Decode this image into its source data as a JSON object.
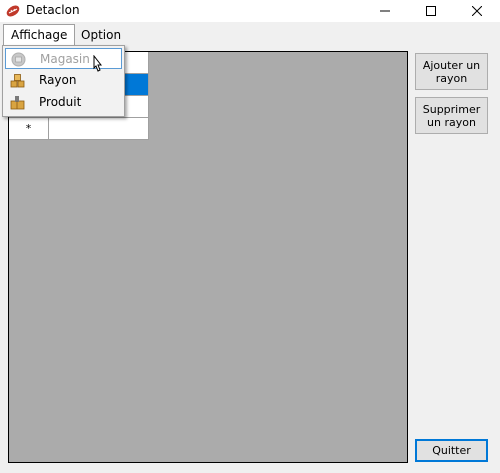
{
  "window": {
    "title": "Detaclon",
    "icon": "app-icon",
    "minimize_icon": "minimize-icon",
    "maximize_icon": "maximize-icon",
    "close_icon": "close-icon"
  },
  "menubar": {
    "items": [
      {
        "label": "Affichage",
        "active": true
      },
      {
        "label": "Option",
        "active": false
      }
    ]
  },
  "dropdown": {
    "items": [
      {
        "label": "Magasin",
        "icon": "store-icon",
        "enabled": false,
        "hovered": true
      },
      {
        "label": "Rayon",
        "icon": "shelf-icon",
        "enabled": true
      },
      {
        "label": "Produit",
        "icon": "product-icon",
        "enabled": true
      }
    ]
  },
  "grid": {
    "new_row_marker": "*",
    "selection_color": "#0078d7"
  },
  "buttons": {
    "add_label": "Ajouter un rayon",
    "delete_label": "Supprimer un rayon",
    "quit_label": "Quitter"
  },
  "colors": {
    "accent": "#0078d7",
    "grid_background": "#ababab"
  }
}
